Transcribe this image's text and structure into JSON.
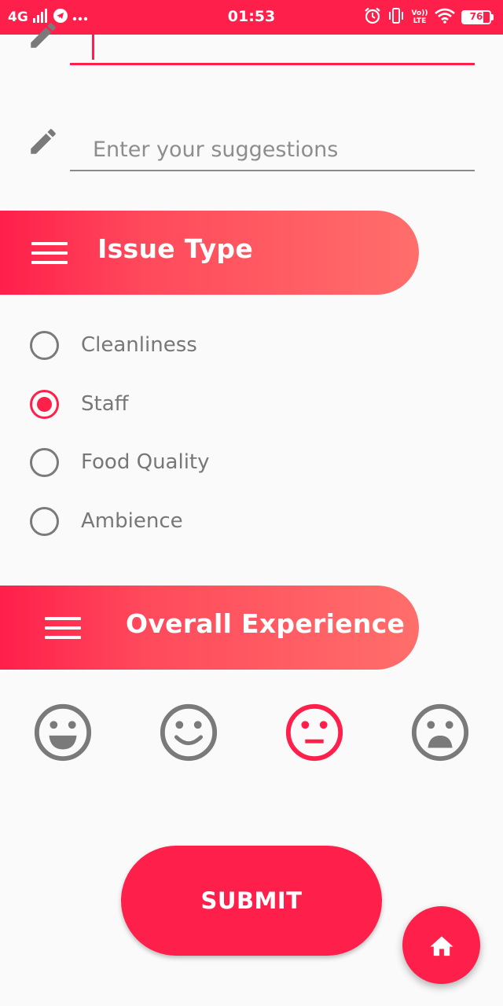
{
  "status_bar": {
    "network": "4G",
    "time": "01:53",
    "volte": "Vo)) LTE",
    "battery": "76",
    "battery_level": 0.76,
    "icons": [
      "signal-icon",
      "telegram-icon",
      "more-dots-icon",
      "alarm-icon",
      "vibrate-icon",
      "volte-icon",
      "wifi-icon",
      "battery-icon"
    ]
  },
  "form": {
    "previous_field_value": "",
    "suggestions_placeholder": "Enter your suggestions"
  },
  "issue_type": {
    "title": "Issue Type",
    "options": [
      {
        "label": "Cleanliness",
        "selected": false
      },
      {
        "label": "Staff",
        "selected": true
      },
      {
        "label": "Food Quality",
        "selected": false
      },
      {
        "label": "Ambience",
        "selected": false
      }
    ]
  },
  "overall_experience": {
    "title": "Overall Experience",
    "faces": [
      {
        "icon": "very-happy-face-icon",
        "selected": false
      },
      {
        "icon": "happy-face-icon",
        "selected": false
      },
      {
        "icon": "neutral-face-icon",
        "selected": true
      },
      {
        "icon": "sad-face-icon",
        "selected": false
      }
    ]
  },
  "submit_label": "SUBMIT",
  "fab_icon": "home-icon",
  "colors": {
    "accent": "#ff1f4b",
    "gradient_end": "#ff6e6b",
    "muted": "#777777",
    "background": "#fafafa"
  }
}
